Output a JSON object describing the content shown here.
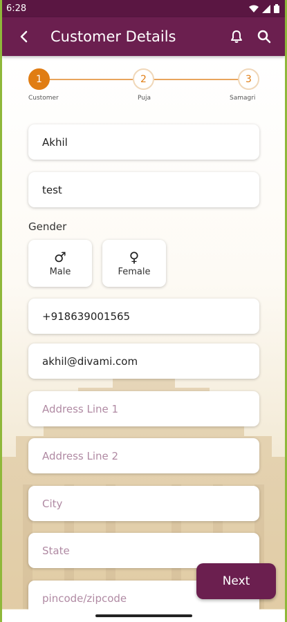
{
  "status_bar": {
    "time": "6:28"
  },
  "app_bar": {
    "title": "Customer Details",
    "back_icon": "arrow-left-icon",
    "notification_icon": "bell-icon",
    "search_icon": "search-icon"
  },
  "stepper": {
    "steps": [
      {
        "number": "1",
        "label": "Customer",
        "active": true
      },
      {
        "number": "2",
        "label": "Puja",
        "active": false
      },
      {
        "number": "3",
        "label": "Samagri",
        "active": false
      }
    ]
  },
  "form": {
    "first_name": {
      "value": "Akhil"
    },
    "last_name": {
      "value": "test"
    },
    "gender_label": "Gender",
    "gender_options": [
      {
        "label": "Male",
        "symbol": "♂"
      },
      {
        "label": "Female",
        "symbol": "♀"
      }
    ],
    "phone": {
      "value": "+918639001565"
    },
    "email": {
      "value": "akhil@divami.com"
    },
    "address1": {
      "placeholder": "Address Line 1"
    },
    "address2": {
      "placeholder": "Address Line 2"
    },
    "city": {
      "placeholder": "City"
    },
    "state": {
      "placeholder": "State"
    },
    "pincode": {
      "placeholder": "pincode/zipcode"
    }
  },
  "next_button": {
    "label": "Next"
  },
  "colors": {
    "primary": "#6b1f4f",
    "accent": "#e07d14",
    "placeholder": "#b08aa3"
  }
}
